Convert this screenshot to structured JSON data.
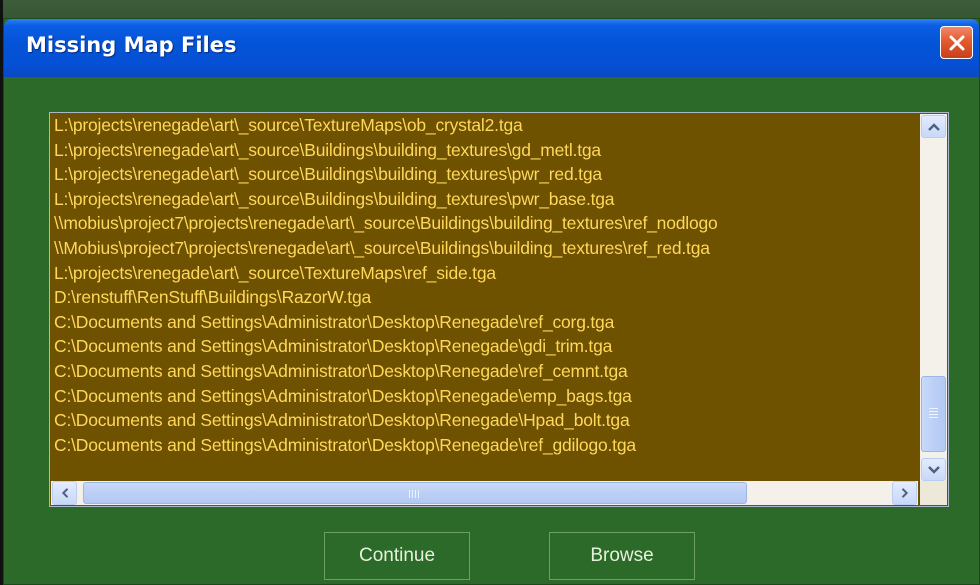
{
  "window": {
    "title": "Missing Map Files"
  },
  "files": [
    "L:\\projects\\renegade\\art\\_source\\TextureMaps\\ob_crystal2.tga",
    "L:\\projects\\renegade\\art\\_source\\Buildings\\building_textures\\gd_metl.tga",
    "L:\\projects\\renegade\\art\\_source\\Buildings\\building_textures\\pwr_red.tga",
    "L:\\projects\\renegade\\art\\_source\\Buildings\\building_textures\\pwr_base.tga",
    "\\\\mobius\\project7\\projects\\renegade\\art\\_source\\Buildings\\building_textures\\ref_nodlogo",
    "\\\\Mobius\\project7\\projects\\renegade\\art\\_source\\Buildings\\building_textures\\ref_red.tga",
    "L:\\projects\\renegade\\art\\_source\\TextureMaps\\ref_side.tga",
    "D:\\renstuff\\RenStuff\\Buildings\\RazorW.tga",
    "C:\\Documents and Settings\\Administrator\\Desktop\\Renegade\\ref_corg.tga",
    "C:\\Documents and Settings\\Administrator\\Desktop\\Renegade\\gdi_trim.tga",
    "C:\\Documents and Settings\\Administrator\\Desktop\\Renegade\\ref_cemnt.tga",
    "C:\\Documents and Settings\\Administrator\\Desktop\\Renegade\\emp_bags.tga",
    "C:\\Documents and Settings\\Administrator\\Desktop\\Renegade\\Hpad_bolt.tga",
    "C:\\Documents and Settings\\Administrator\\Desktop\\Renegade\\ref_gdilogo.tga"
  ],
  "buttons": {
    "continue": "Continue",
    "browse": "Browse"
  },
  "scroll": {
    "vertical_position": 0.78,
    "horizontal_position": 0.0
  },
  "colors": {
    "list_background": "#6e5200",
    "list_text": "#ffd75a",
    "dialog_background": "#2c6a29",
    "titlebar": "#0454d8",
    "close_button": "#e25a2e"
  },
  "icons": {
    "close": "close-icon",
    "scroll_up": "arrow-up-icon",
    "scroll_down": "arrow-down-icon",
    "scroll_left": "arrow-left-icon",
    "scroll_right": "arrow-right-icon"
  }
}
